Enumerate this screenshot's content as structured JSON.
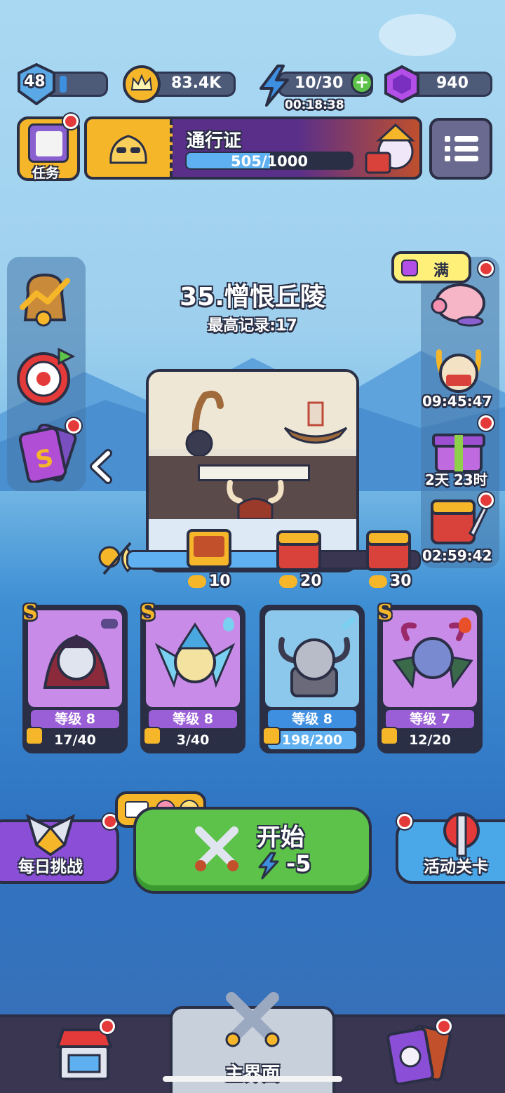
{
  "top_bar": {
    "player_level": "48",
    "coins": "83.4K",
    "energy": "10/30",
    "energy_timer": "00:18:38",
    "gems": "940"
  },
  "quest": {
    "label": "任务"
  },
  "pass": {
    "title": "通行证",
    "progress_text": "505/1000",
    "progress_fraction": 0.505
  },
  "stage": {
    "title": "35.憎恨丘陵",
    "record": "最高记录:17"
  },
  "piggy": {
    "label": "满"
  },
  "right_timers": {
    "boss_timer": "09:45:47",
    "gift_timer": "2天 23时",
    "chest_timer": "02:59:42"
  },
  "milestones": [
    {
      "label": "10"
    },
    {
      "label": "20"
    },
    {
      "label": "30"
    }
  ],
  "milestone_progress_fraction": 0.62,
  "heroes": [
    {
      "rarity": "S",
      "level": "等级 8",
      "progress": "17/40",
      "fraction": 0.425,
      "bg": "#c98be8"
    },
    {
      "rarity": "S",
      "level": "等级 8",
      "progress": "3/40",
      "fraction": 0.075,
      "bg": "#c98be8"
    },
    {
      "rarity": "",
      "level": "等级 8",
      "progress": "198/200",
      "fraction": 0.99,
      "bg": "#8cc8ec"
    },
    {
      "rarity": "S",
      "level": "等级 7",
      "progress": "12/20",
      "fraction": 0.6,
      "bg": "#c98be8"
    }
  ],
  "buttons": {
    "daily_challenge": "每日挑战",
    "start": "开始",
    "start_cost": "-5",
    "event_stage": "活动关卡"
  },
  "bottom_nav": {
    "main_label": "主界面"
  },
  "colors": {
    "purple": "#8a4fd6",
    "green": "#5cc24a",
    "blue": "#3aa0e8",
    "gold": "#f5b62a"
  }
}
